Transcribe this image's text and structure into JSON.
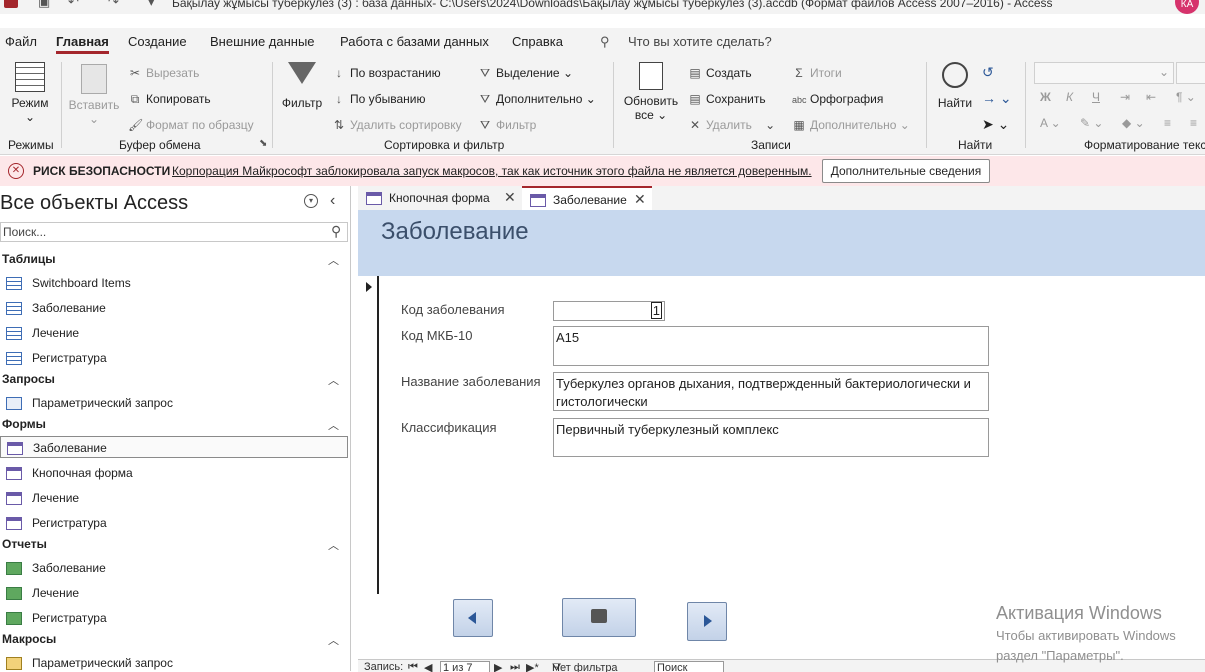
{
  "titlebar": {
    "title": "Бақылау жұмысы туберкулез (3) : база данных- C:\\Users\\2024\\Downloads\\Бақылау жұмысы туберкулез (3).accdb (Формат файлов Access 2007–2016)  -  Access",
    "user_initials": "КА"
  },
  "menu": {
    "file": "Файл",
    "home": "Главная",
    "create": "Создание",
    "external": "Внешние данные",
    "dbtools": "Работа с базами данных",
    "help": "Справка",
    "tellme": "Что вы хотите сделать?"
  },
  "ribbon": {
    "views": {
      "mode": "Режим",
      "group": "Режимы"
    },
    "clipboard": {
      "paste": "Вставить",
      "cut": "Вырезать",
      "copy": "Копировать",
      "format_painter": "Формат по образцу",
      "group": "Буфер обмена"
    },
    "sort": {
      "filter": "Фильтр",
      "asc": "По возрастанию",
      "desc": "По убыванию",
      "remove_sort": "Удалить сортировку",
      "selection": "Выделение",
      "advanced": "Дополнительно",
      "toggle_filter": "Фильтр",
      "group": "Сортировка и фильтр"
    },
    "records": {
      "refresh": "Обновить",
      "refresh2": "все",
      "new": "Создать",
      "save": "Сохранить",
      "delete": "Удалить",
      "totals": "Итоги",
      "spelling": "Орфография",
      "more": "Дополнительно",
      "group": "Записи"
    },
    "find": {
      "find": "Найти",
      "group": "Найти"
    },
    "format": {
      "group": "Форматирование текста",
      "bold": "Ж",
      "italic": "К",
      "underline": "Ч"
    }
  },
  "security": {
    "title": "РИСК БЕЗОПАСНОСТИ",
    "message": "Корпорация Майкрософт заблокировала запуск макросов, так как источник этого файла не является доверенным.",
    "button": "Дополнительные сведения"
  },
  "nav": {
    "header": "Все объекты Access",
    "search_placeholder": "Поиск...",
    "sections": {
      "tables": "Таблицы",
      "queries": "Запросы",
      "forms": "Формы",
      "reports": "Отчеты",
      "macros": "Макросы"
    },
    "tables": [
      "Switchboard Items",
      "Заболевание",
      "Лечение",
      "Регистратура"
    ],
    "queries": [
      "Параметрический запрос"
    ],
    "forms": [
      "Заболевание",
      "Кнопочная форма",
      "Лечение",
      "Регистратура"
    ],
    "reports": [
      "Заболевание",
      "Лечение",
      "Регистратура"
    ],
    "macros": [
      "Параметрический запрос"
    ]
  },
  "tabs": [
    {
      "label": "Кнопочная форма",
      "active": false
    },
    {
      "label": "Заболевание",
      "active": true
    }
  ],
  "form": {
    "title": "Заболевание",
    "fields": [
      {
        "label": "Код заболевания",
        "value": "1"
      },
      {
        "label": "Код МКБ-10",
        "value": "A15"
      },
      {
        "label": "Название заболевания",
        "value": "Туберкулез органов дыхания, подтвержденный бактериологически и гистологически"
      },
      {
        "label": "Классификация",
        "value": "Первичный туберкулезный комплекс"
      }
    ]
  },
  "record_nav": {
    "label": "Запись:",
    "position": "1 из 7",
    "filter": "Нет фильтра",
    "search": "Поиск"
  },
  "watermark": {
    "line1": "Активация Windows",
    "line2": "Чтобы активировать Windows",
    "line3": "раздел \"Параметры\"."
  },
  "colors": {
    "accent": "#a4262c",
    "form_header": "#c7d8ee",
    "security_bg": "#fde7e9"
  }
}
